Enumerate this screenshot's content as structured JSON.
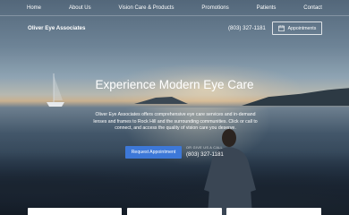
{
  "nav": {
    "items": [
      {
        "label": "Home"
      },
      {
        "label": "About Us"
      },
      {
        "label": "Vision Care & Products"
      },
      {
        "label": "Promotions"
      },
      {
        "label": "Patients"
      },
      {
        "label": "Contact"
      }
    ]
  },
  "header": {
    "brand": "Oliver Eye Associates",
    "phone": "(803) 327-1181",
    "appointments_label": "Appointments"
  },
  "hero": {
    "headline": "Experience Modern Eye Care",
    "description": "Oliver Eye Associates offers comprehensive eye care services and in-demand lenses and frames to Rock Hill and the surrounding communities. Click or call to connect, and access the quality of vision care you deserve.",
    "cta_label": "Request Appointment",
    "call_label": "OR GIVE US A CALL",
    "call_number": "(803) 327-1181"
  },
  "colors": {
    "accent": "#3d78d8",
    "text": "#ffffff"
  }
}
